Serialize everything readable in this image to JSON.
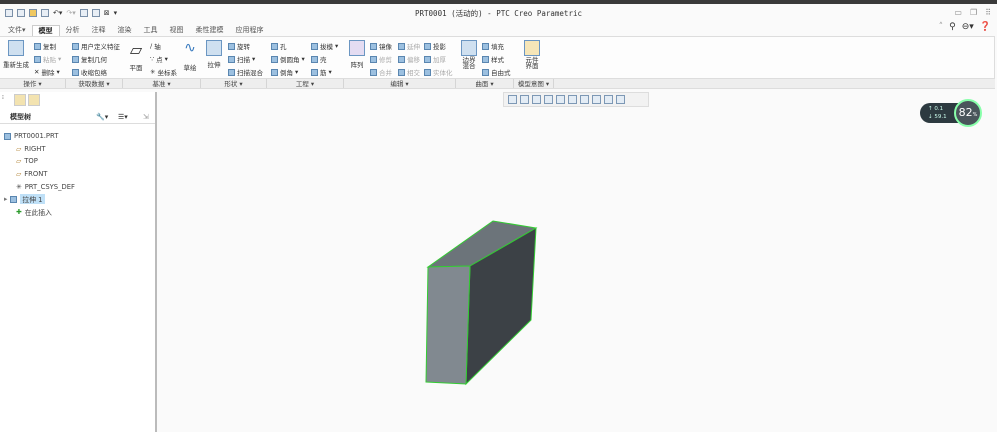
{
  "window": {
    "title": "PRT0001 (活动的) - PTC Creo Parametric"
  },
  "tabs": [
    "文件",
    "模型",
    "分析",
    "注释",
    "渲染",
    "工具",
    "视图",
    "柔性建模",
    "应用程序"
  ],
  "ribbon": {
    "ops": {
      "regen": "重新生成",
      "copy": "复制",
      "paste": "粘贴",
      "delete": "删除"
    },
    "get": {
      "udf": "用户定义特征",
      "copygeom": "复制几何",
      "shrinkwrap": "收缩包络"
    },
    "datum": {
      "plane": "平面",
      "axis": "轴",
      "point": "点",
      "csys": "坐标系",
      "sketch": "草绘"
    },
    "shape": {
      "extrude": "拉伸",
      "revolve": "旋转",
      "sweep": "扫描",
      "swept_blend": "扫描混合"
    },
    "eng": {
      "hole": "孔",
      "draft": "拔模",
      "round": "倒圆角",
      "shell": "壳",
      "chamfer": "倒角",
      "rib": "筋"
    },
    "edit": {
      "pattern": "阵列",
      "mirror": "镜像",
      "extend": "延伸",
      "project": "投影",
      "trim": "修剪",
      "offset": "偏移",
      "thicken": "加厚",
      "merge": "合并",
      "intersect": "相交",
      "solidify": "实体化"
    },
    "surface": {
      "boundary_blend": "边界混合",
      "fill": "填充",
      "style": "样式",
      "freestyle": "自由式"
    },
    "intent": {
      "component_interface": "元件界面"
    }
  },
  "groups": [
    "操作",
    "获取数据",
    "基准",
    "形状",
    "工程",
    "编辑",
    "曲面",
    "模型意图"
  ],
  "tree": {
    "header": "模型树",
    "items": [
      "PRT0001.PRT",
      "RIGHT",
      "TOP",
      "FRONT",
      "PRT_CSYS_DEF",
      "拉伸 1",
      "在此插入"
    ]
  },
  "perf": {
    "up": "0.1",
    "down": "59.1",
    "percent": "82",
    "unit": "%"
  }
}
